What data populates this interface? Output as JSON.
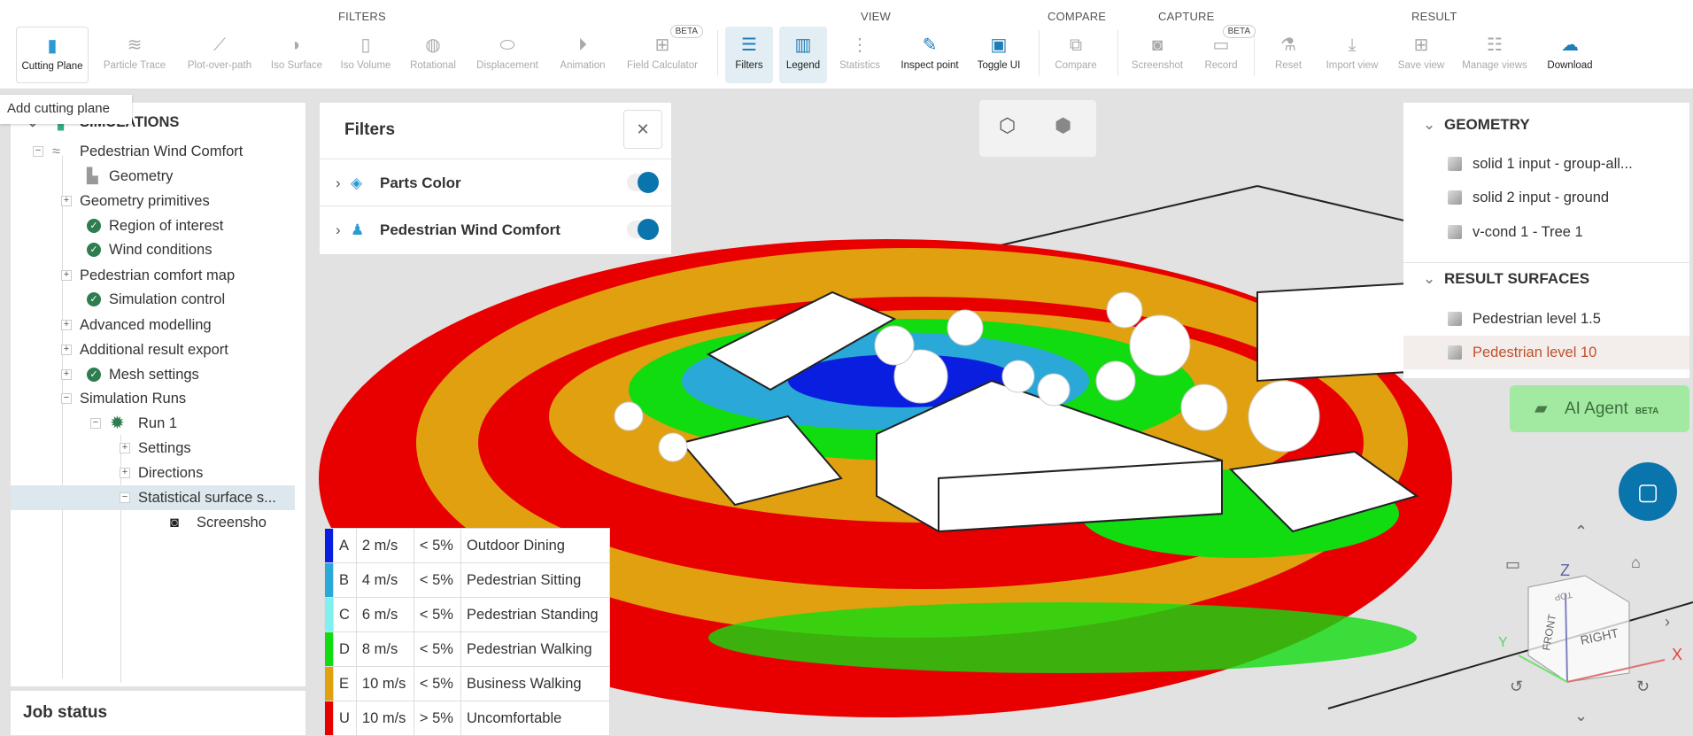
{
  "toolbar": {
    "groups": {
      "filters": "FILTERS",
      "view": "VIEW",
      "compare": "COMPARE",
      "capture": "CAPTURE",
      "result": "RESULT"
    },
    "items": [
      {
        "label": "Cutting Plane",
        "icon": "cutting-plane-icon"
      },
      {
        "label": "Particle Trace",
        "icon": "particle-trace-icon"
      },
      {
        "label": "Plot-over-path",
        "icon": "plot-icon"
      },
      {
        "label": "Iso Surface",
        "icon": "iso-surface-icon"
      },
      {
        "label": "Iso Volume",
        "icon": "iso-volume-icon"
      },
      {
        "label": "Rotational",
        "icon": "rotational-icon"
      },
      {
        "label": "Displacement",
        "icon": "displacement-icon"
      },
      {
        "label": "Animation",
        "icon": "play-icon"
      },
      {
        "label": "Field Calculator",
        "icon": "calculator-icon",
        "badge": "BETA"
      },
      {
        "label": "Filters",
        "icon": "sliders-icon"
      },
      {
        "label": "Legend",
        "icon": "legend-icon"
      },
      {
        "label": "Statistics",
        "icon": "statistics-icon"
      },
      {
        "label": "Inspect point",
        "icon": "pipette-icon"
      },
      {
        "label": "Toggle UI",
        "icon": "window-icon"
      },
      {
        "label": "Compare",
        "icon": "compare-icon"
      },
      {
        "label": "Screenshot",
        "icon": "camera-icon"
      },
      {
        "label": "Record",
        "icon": "video-icon",
        "badge": "BETA"
      },
      {
        "label": "Reset",
        "icon": "flask-icon"
      },
      {
        "label": "Import view",
        "icon": "import-icon"
      },
      {
        "label": "Save view",
        "icon": "plus-icon"
      },
      {
        "label": "Manage views",
        "icon": "manage-icon"
      },
      {
        "label": "Download",
        "icon": "cloud-download-icon"
      }
    ]
  },
  "tooltip": "Add cutting plane",
  "tree": {
    "root": "SIMULATIONS",
    "rows": [
      "Pedestrian Wind Comfort",
      "Geometry",
      "Geometry primitives",
      "Region of interest",
      "Wind conditions",
      "Pedestrian comfort map",
      "Simulation control",
      "Advanced modelling",
      "Additional result export",
      "Mesh settings",
      "Simulation Runs",
      "Run 1",
      "Settings",
      "Directions",
      "Statistical surface s...",
      "Screensho"
    ]
  },
  "job_status": "Job status",
  "filters_panel": {
    "title": "Filters",
    "items": [
      {
        "label": "Parts Color",
        "on": true
      },
      {
        "label": "Pedestrian Wind Comfort",
        "on": true
      }
    ]
  },
  "right_panel": {
    "geometry_title": "GEOMETRY",
    "geometry": [
      "solid 1 input - group-all...",
      "solid 2 input - ground",
      "v-cond 1 - Tree 1"
    ],
    "results_title": "RESULT SURFACES",
    "results": [
      "Pedestrian level 1.5",
      "Pedestrian level 10"
    ]
  },
  "ai_agent": {
    "label": "AI Agent",
    "badge": "BETA"
  },
  "legend": [
    {
      "code": "A",
      "speed": "2 m/s",
      "freq": "< 5%",
      "name": "Outdoor Dining",
      "color": "#0a1ee0"
    },
    {
      "code": "B",
      "speed": "4 m/s",
      "freq": "< 5%",
      "name": "Pedestrian Sitting",
      "color": "#2aa8d8"
    },
    {
      "code": "C",
      "speed": "6 m/s",
      "freq": "< 5%",
      "name": "Pedestrian Standing",
      "color": "#80f0f0"
    },
    {
      "code": "D",
      "speed": "8 m/s",
      "freq": "< 5%",
      "name": "Pedestrian Walking",
      "color": "#10dc10"
    },
    {
      "code": "E",
      "speed": "10 m/s",
      "freq": "< 5%",
      "name": "Business Walking",
      "color": "#e0a010"
    },
    {
      "code": "U",
      "speed": "10 m/s",
      "freq": "> 5%",
      "name": "Uncomfortable",
      "color": "#e80000"
    }
  ],
  "viewcube": {
    "z": "Z",
    "x": "X",
    "y": "Y",
    "front": "FRONT",
    "right": "RIGHT",
    "top": "TOP"
  }
}
